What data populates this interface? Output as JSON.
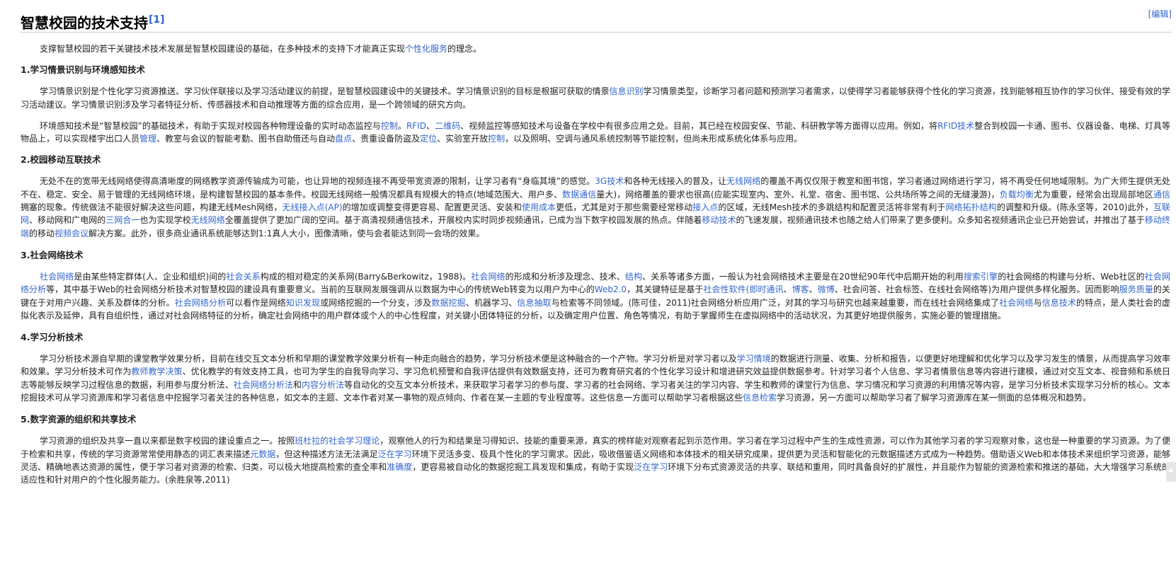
{
  "section": {
    "title": "智慧校园的技术支持",
    "ref": "[1]",
    "edit_label": "[编辑]"
  },
  "blocks": [
    {
      "type": "p",
      "parts": [
        {
          "t": "支撑智慧校园的若干关键技术技术发展是智慧校园建设的基础，在多种技术的支持下才能真正实现"
        },
        {
          "t": "个性化服务",
          "link": true
        },
        {
          "t": "的理念。"
        }
      ]
    },
    {
      "type": "h",
      "text": "1.学习情景识别与环境感知技术"
    },
    {
      "type": "p",
      "parts": [
        {
          "t": "学习情景识别是个性化学习资源推送、学习伙伴联接以及学习活动建议的前提，是智慧校园建设中的关键技术。学习情景识别的目标是根据可获取的情景"
        },
        {
          "t": "信息识别",
          "link": true
        },
        {
          "t": "学习情景类型，诊断学习者问题和预测学习者需求，以使得学习者能够获得个性化的学习资源，找到能够相互协作的学习伙伴、接受有效的学习活动建议。学习情景识别涉及学习者特征分析、传感器技术和自动推理等方面的综合应用，是一个跨领域的研究方向。"
        }
      ]
    },
    {
      "type": "p",
      "parts": [
        {
          "t": "环境感知技术是“智慧校园”的基础技术，有助于实现对校园各种物理设备的实时动态监控与"
        },
        {
          "t": "控制",
          "link": true
        },
        {
          "t": "。"
        },
        {
          "t": "RFID",
          "link": true
        },
        {
          "t": "、"
        },
        {
          "t": "二维码",
          "link": true
        },
        {
          "t": "、视频监控等感知技术与设备在学校中有很多应用之处。目前，其已经在校园安保、节能、科研教学等方面得以应用。例如，将"
        },
        {
          "t": "RFID技术",
          "link": true
        },
        {
          "t": "整合到校园一卡通、图书、仪器设备、电梯、灯具等物品上，可以实现楼宇出口人员"
        },
        {
          "t": "管理",
          "link": true
        },
        {
          "t": "、教室与会议的智能考勤、图书自助借还与自动"
        },
        {
          "t": "盘点",
          "link": true
        },
        {
          "t": "、贵重设备防盗及"
        },
        {
          "t": "定位",
          "link": true
        },
        {
          "t": "、实验室开放"
        },
        {
          "t": "控制",
          "link": true
        },
        {
          "t": "，以及照明、空调与通风系统控制等节能控制，但尚未形成系统化体系与应用。"
        }
      ]
    },
    {
      "type": "h",
      "text": "2.校园移动互联技术"
    },
    {
      "type": "p",
      "parts": [
        {
          "t": "无处不在的宽带无线网络使得高清晰度的网络教学资源传输成为可能，也让异地的视频连接不再受带宽资源的限制，让学习者有“身临其境”的感觉。"
        },
        {
          "t": "3G技术",
          "link": true
        },
        {
          "t": "和各种无线接入的普及，让"
        },
        {
          "t": "无线网络",
          "link": true
        },
        {
          "t": "的覆盖不再仅仅限于教室和图书馆，学习者通过网络进行学习，将不再受任何地域限制。为广大师生提供无处不在、稳定、安全、易于管理的无线网络环境，是构建智慧校园的基本条件。校园无线网络一般情况都具有规模大的特点(地域范围大、用户多、"
        },
        {
          "t": "数据通信",
          "link": true
        },
        {
          "t": "量大)，网络覆盖的要求也很高(应能实现室内、室外、礼堂、宿舍、图书馆、公共场所等之间的无缝漫游)，"
        },
        {
          "t": "负载均衡",
          "link": true
        },
        {
          "t": "尤为重要，经常会出现局部地区"
        },
        {
          "t": "通信",
          "link": true
        },
        {
          "t": "拥塞的现象。传统做法不能很好解决这些问题，构建无线Mesh网络，"
        },
        {
          "t": "无线接入点",
          "link": true
        },
        {
          "t": "(AP)",
          "link": true
        },
        {
          "t": "的增加或调整变得更容易、配置更灵活、安装和"
        },
        {
          "t": "使用成本",
          "link": true
        },
        {
          "t": "更低，尤其是对于那些需要经常移动"
        },
        {
          "t": "接入点",
          "link": true
        },
        {
          "t": "的区域，无线Mesh技术的多跳结构和配置灵活将非常有利于"
        },
        {
          "t": "网络拓扑结构",
          "link": true
        },
        {
          "t": "的调整和升级。(陈永坚等，2010)此外，"
        },
        {
          "t": "互联网",
          "link": true
        },
        {
          "t": "、移动网和广电网的"
        },
        {
          "t": "三网合一",
          "link": true
        },
        {
          "t": "也为实现学校"
        },
        {
          "t": "无线网络",
          "link": true
        },
        {
          "t": "全覆盖提供了更加广阔的空间。基于高清视频通信技术，开展校内实时同步视频通讯，已成为当下数字校园发展的热点。伴随着"
        },
        {
          "t": "移动技术",
          "link": true
        },
        {
          "t": "的飞速发展，视频通讯技术也随之给人们带来了更多便利。众多知名视频通讯企业已开始尝试，并推出了基于"
        },
        {
          "t": "移动终端",
          "link": true
        },
        {
          "t": "的移动"
        },
        {
          "t": "视频会议",
          "link": true
        },
        {
          "t": "解决方案。此外，很多商业通讯系统能够达到1:1真人大小，图像清晰，使与会者能达到同一会场的效果。"
        }
      ]
    },
    {
      "type": "h",
      "text": "3.社会网络技术"
    },
    {
      "type": "p",
      "parts": [
        {
          "t": "社会网络",
          "link": true
        },
        {
          "t": "是由某些特定群体(人、企业和组织)间的"
        },
        {
          "t": "社会关系",
          "link": true
        },
        {
          "t": "构成的相对稳定的关系网(Barry&Berkowitz，1988)。"
        },
        {
          "t": "社会网络",
          "link": true
        },
        {
          "t": "的形成和分析涉及理念、技术、"
        },
        {
          "t": "结构",
          "link": true
        },
        {
          "t": "、关系等诸多方面，一般认为社会网络技术主要是在20世纪90年代中后期开始的利用"
        },
        {
          "t": "搜索引擎",
          "link": true
        },
        {
          "t": "的社会网络的构建与分析、Web社区的"
        },
        {
          "t": "社会网络分析",
          "link": true
        },
        {
          "t": "等，其中基于Web的社会网络分析技术对智慧校园的建设具有重要意义。当前的互联网发展强调从以数据为中心的传统Web转变为以用户为中心的"
        },
        {
          "t": "Web2.0",
          "link": true
        },
        {
          "t": "，其关键特征是基于"
        },
        {
          "t": "社会性软件",
          "link": true
        },
        {
          "t": "(",
          "link": true
        },
        {
          "t": "即时通讯",
          "link": true
        },
        {
          "t": "、"
        },
        {
          "t": "博客",
          "link": true
        },
        {
          "t": "、"
        },
        {
          "t": "微博",
          "link": true
        },
        {
          "t": "、社会问答、社会标签、在线社会网络等)为用户提供多样化服务。因而影响"
        },
        {
          "t": "服务质量",
          "link": true
        },
        {
          "t": "的关键在于对用户兴趣、关系及群体的分析。"
        },
        {
          "t": "社会网络分析",
          "link": true
        },
        {
          "t": "可以看作是网络"
        },
        {
          "t": "知识发现",
          "link": true
        },
        {
          "t": "或网络挖掘的一个分支，涉及"
        },
        {
          "t": "数据挖掘",
          "link": true
        },
        {
          "t": "、机器学习、"
        },
        {
          "t": "信息抽取",
          "link": true
        },
        {
          "t": "与检索等不同领域。(陈可佳，2011)社会网络分析应用广泛，对其的学习与研究也越来越重要，而在线社会网络集成了"
        },
        {
          "t": "社会网络",
          "link": true
        },
        {
          "t": "与"
        },
        {
          "t": "信息技术",
          "link": true
        },
        {
          "t": "的特点，是人类社会的虚拟化表示及延伸，具有自组织性，通过对社会网络特征的分析，确定社会网络中的用户群体或个人的中心性程度，对关键小团体特征的分析，以及确定用户位置、角色等情况，有助于掌握师生在虚拟网络中的活动状况，为其更好地提供服务，实施必要的管理措施。"
        }
      ]
    },
    {
      "type": "h",
      "text": "4.学习分析技术"
    },
    {
      "type": "p",
      "parts": [
        {
          "t": "学习分析技术源自早期的课堂教学效果分析，目前在线交互文本分析和早期的课堂教学效果分析有一种走向融合的趋势，学习分析技术便是这种融合的一个产物。学习分析是对学习者以及"
        },
        {
          "t": "学习情境",
          "link": true
        },
        {
          "t": "的数据进行测量、收集、分析和报告，以便更好地理解和优化学习以及学习发生的情景，从而提高学习效率和效果。学习分析技术可作为"
        },
        {
          "t": "教师教学决策",
          "link": true
        },
        {
          "t": "、优化教学的有效支持工具，也可为学生的自我导向学习、学习危机预警和自我评估提供有效数据支持，还可为教育研究者的个性化学习设计和增进研究效益提供数据参考。针对学习者个人信息、学习者情景信息等内容进行建模，通过对交互文本、视音频和系统日志等能够反映学习过程信息的数据，利用参与度分析法、"
        },
        {
          "t": "社会网络分析法",
          "link": true
        },
        {
          "t": "和"
        },
        {
          "t": "内容分析法",
          "link": true
        },
        {
          "t": "等自动化的交互文本分析技术，来获取学习者学习的参与度、学习者的社会网络、学习者关注的学习内容、学生和教师的课堂行为信息、学习情况和学习资源的利用情况等内容，是学习分析技术实现学习分析的核心。文本挖掘技术可从学习资源库和学习者信息中挖掘学习者关注的各种信息，如文本的主题、文本作者对某一事物的观点倾向、作者在某一主题的专业程度等。这些信息一方面可以帮助学习者根据这些"
        },
        {
          "t": "信息检索",
          "link": true
        },
        {
          "t": "学习资源，另一方面可以帮助学习者了解学习资源库在某一侧面的总体概况和趋势。"
        }
      ]
    },
    {
      "type": "h",
      "text": "5.数字资源的组织和共享技术"
    },
    {
      "type": "p",
      "parts": [
        {
          "t": "学习资源的组织及共享一直以来都是数字校园的建设重点之一。按照"
        },
        {
          "t": "班杜拉的社会学习理论",
          "link": true
        },
        {
          "t": "，观察他人的行为和结果是习得知识、技能的重要来源，真实的榜样能对观察者起到示范作用。学习者在学习过程中产生的生成性资源，可以作为其他学习者的学习观察对象，这也是一种重要的学习资源。为了便于检索和共享，传统的学习资源常常使用静态的词汇表来描述"
        },
        {
          "t": "元数据",
          "link": true
        },
        {
          "t": "，但这种描述方法无法满足"
        },
        {
          "t": "泛在学习",
          "link": true
        },
        {
          "t": "环境下灵活多变、极具个性化的学习需求。因此，吸收借鉴语义网络和本体技术的相关研究成果，提供更为灵活和智能化的元数据描述方式成为一种趋势。借助语义Web和本体技术来组织学习资源，能够灵活、精确地表达资源的属性，便于学习者对资源的检索、归类，可以极大地提高检索的查全率和"
        },
        {
          "t": "准确度",
          "link": true
        },
        {
          "t": "，更容易被自动化的数据挖掘工具发现和集成，有助于实现"
        },
        {
          "t": "泛在学习",
          "link": true
        },
        {
          "t": "环境下分布式资源灵活的共享、联结和重用，同时具备良好的扩展性，并且能作为智能的资源检索和推送的基础，大大增强学习系统的适应性和针对用户的个性化服务能力。(余胜泉等,2011)"
        }
      ]
    }
  ]
}
